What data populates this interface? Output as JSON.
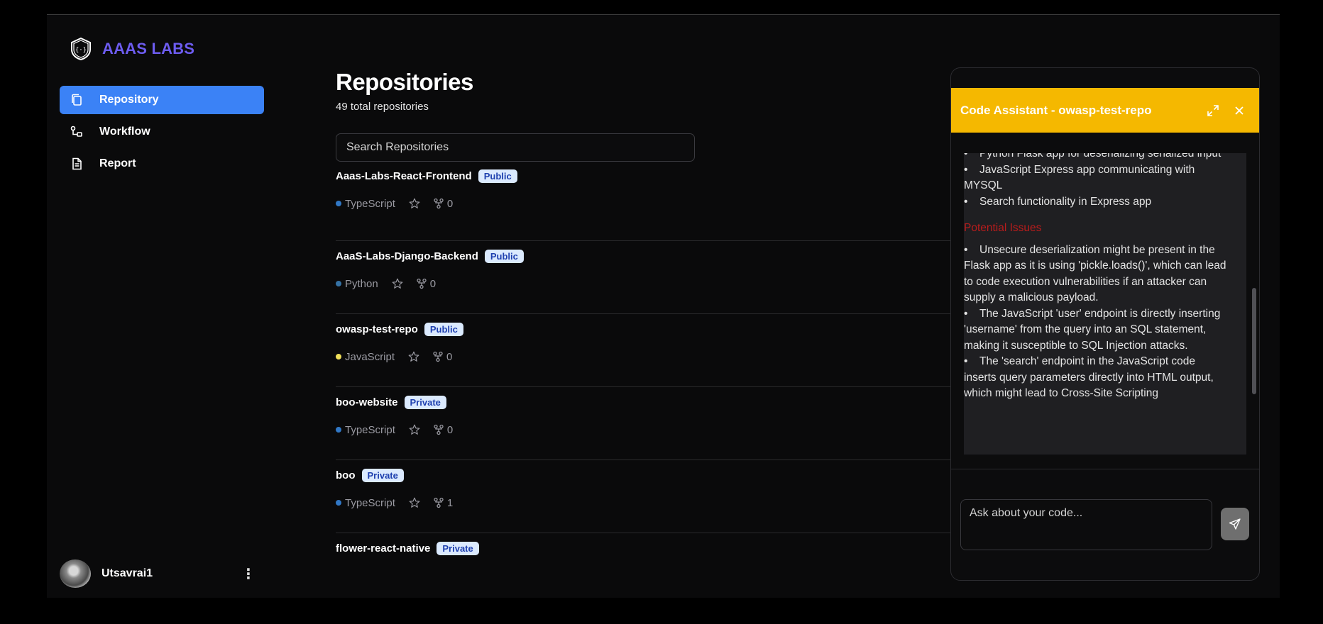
{
  "brand": {
    "name": "AAAS LABS"
  },
  "sidebar": {
    "items": [
      {
        "label": "Repository",
        "active": true,
        "icon": "copy-icon"
      },
      {
        "label": "Workflow",
        "active": false,
        "icon": "workflow-icon"
      },
      {
        "label": "Report",
        "active": false,
        "icon": "file-text-icon"
      }
    ]
  },
  "user": {
    "name": "Utsavrai1",
    "menu_glyph": "⋮"
  },
  "main": {
    "title": "Repositories",
    "subtitle": "49 total repositories",
    "search_placeholder": "Search Repositories",
    "repos": [
      {
        "name": "Aaas-Labs-React-Frontend",
        "visibility": "Public",
        "language": "TypeScript",
        "lang_color": "#3178c6",
        "forks": "0"
      },
      {
        "name": "AaaS-Labs-Django-Backend",
        "visibility": "Public",
        "language": "Python",
        "lang_color": "#3572a5",
        "forks": "0"
      },
      {
        "name": "owasp-test-repo",
        "visibility": "Public",
        "language": "JavaScript",
        "lang_color": "#f1e05a",
        "forks": "0"
      },
      {
        "name": "boo-website",
        "visibility": "Private",
        "language": "TypeScript",
        "lang_color": "#3178c6",
        "forks": "0"
      },
      {
        "name": "boo",
        "visibility": "Private",
        "language": "TypeScript",
        "lang_color": "#3178c6",
        "forks": "1"
      },
      {
        "name": "flower-react-native",
        "visibility": "Private",
        "language": "",
        "lang_color": "",
        "forks": ""
      }
    ]
  },
  "assistant": {
    "title": "Code Assistant - owasp-test-repo",
    "bullets_top": [
      "Python Flask app for deserializing serialized input",
      "JavaScript Express app communicating with MYSQL",
      "Search functionality in Express app"
    ],
    "issues_title": "Potential Issues",
    "issues": [
      "Unsecure deserialization might be present in the Flask app as it is using 'pickle.loads()', which can lead to code execution vulnerabilities if an attacker can supply a malicious payload.",
      "The JavaScript 'user' endpoint is directly inserting 'username' from the query into an SQL statement, making it susceptible to SQL Injection attacks.",
      "The 'search' endpoint in the JavaScript code inserts query parameters directly into HTML output, which might lead to Cross-Site Scripting"
    ],
    "input_placeholder": "Ask about your code...",
    "accent_color": "#f5b800"
  }
}
